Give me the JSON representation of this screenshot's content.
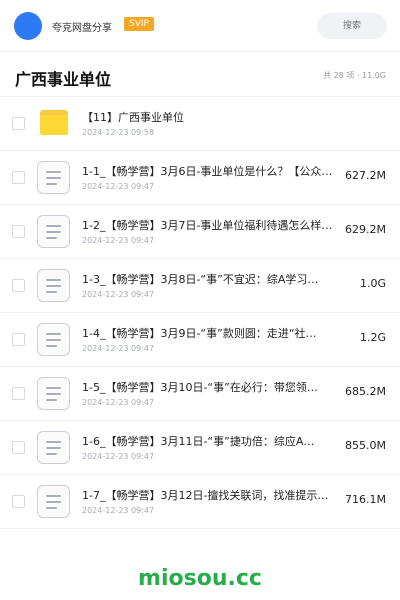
{
  "header": {
    "user_name": "夸克网盘分享",
    "badge": "SVIP",
    "search_placeholder": "搜索"
  },
  "folder": {
    "title": "广西事业单位",
    "summary": "共 28 项 · 11.0G"
  },
  "items": [
    {
      "type": "folder",
      "name": "【11】广西事业单位",
      "date": "2024-12-23 09:58",
      "size": ""
    },
    {
      "type": "file",
      "name": "1-1_【畅学营】3月6日-事业单位是什么？【公众…",
      "date": "2024-12-23 09:47",
      "size": "627.2M"
    },
    {
      "type": "file",
      "name": "1-2_【畅学营】3月7日-事业单位福利待遇怎么样…",
      "date": "2024-12-23 09:47",
      "size": "629.2M"
    },
    {
      "type": "file",
      "name": "1-3_【畅学营】3月8日-“事”不宜迟：综A学习…",
      "date": "2024-12-23 09:47",
      "size": "1.0G"
    },
    {
      "type": "file",
      "name": "1-4_【畅学营】3月9日-“事”款则圆：走进“社…",
      "date": "2024-12-23 09:47",
      "size": "1.2G"
    },
    {
      "type": "file",
      "name": "1-5_【畅学营】3月10日-“事”在必行：带您领…",
      "date": "2024-12-23 09:47",
      "size": "685.2M"
    },
    {
      "type": "file",
      "name": "1-6_【畅学营】3月11日-“事”捷功倍：综应A…",
      "date": "2024-12-23 09:47",
      "size": "855.0M"
    },
    {
      "type": "file",
      "name": "1-7_【畅学营】3月12日-擅找关联词，找准提示…",
      "date": "2024-12-23 09:47",
      "size": "716.1M"
    }
  ],
  "watermark": "miosou.cc",
  "colors": {
    "accent": "#2d7bf4",
    "badge": "#f5a623",
    "folder": "#fdd835",
    "watermark": "#27ae4a"
  }
}
